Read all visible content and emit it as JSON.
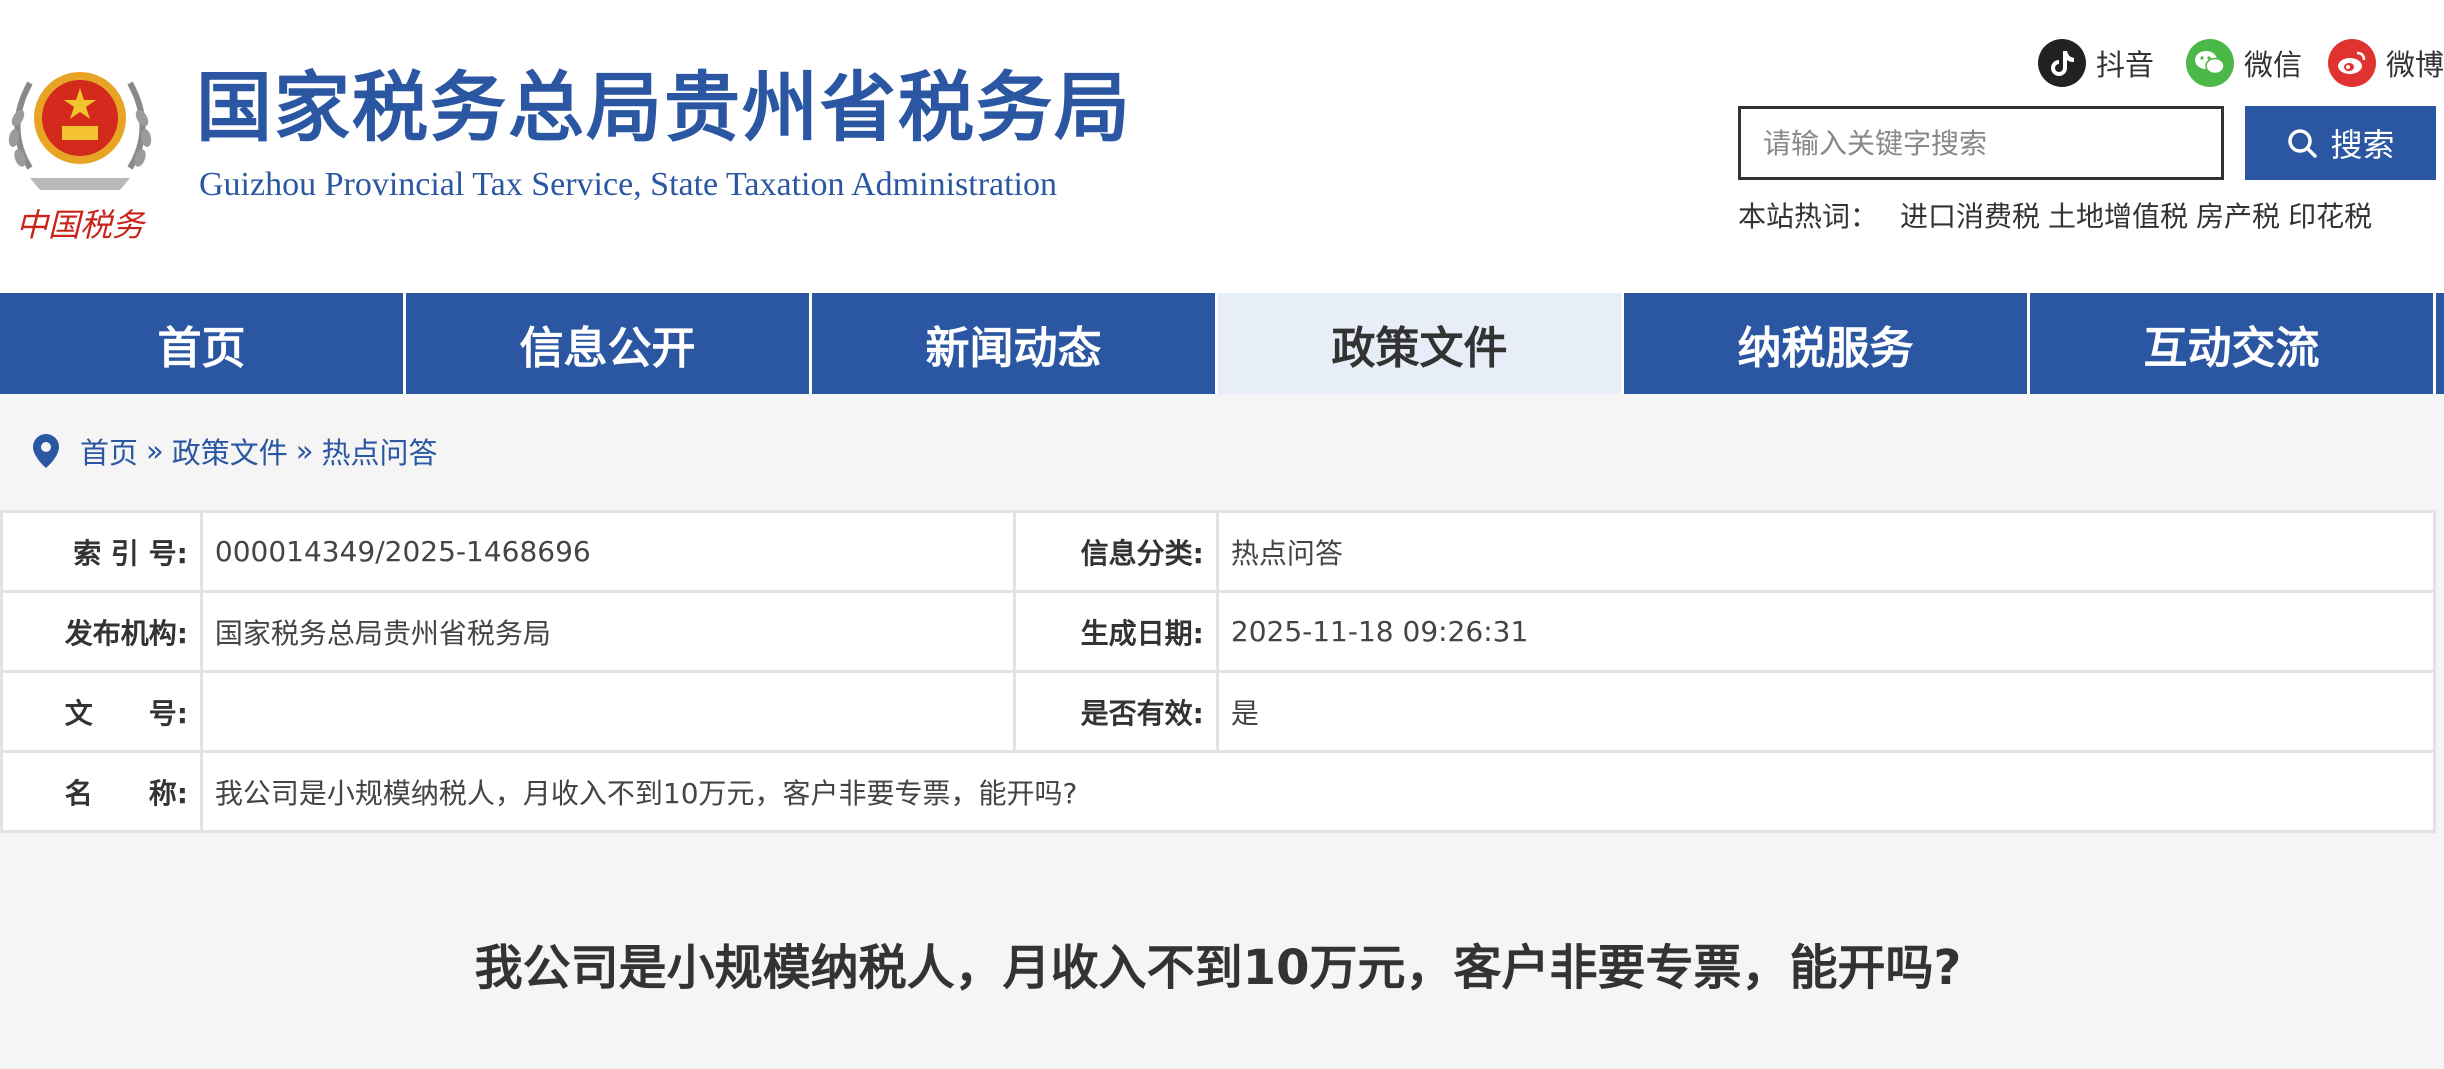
{
  "header": {
    "title_cn": "国家税务总局贵州省税务局",
    "title_en": "Guizhou Provincial Tax Service, State Taxation Administration",
    "emblem_text": "中国税务",
    "social": [
      {
        "label": "抖音",
        "icon": "douyin-icon",
        "color": "#222222"
      },
      {
        "label": "微信",
        "icon": "wechat-icon",
        "color": "#4cb848"
      },
      {
        "label": "微博",
        "icon": "weibo-icon",
        "color": "#e0322e"
      }
    ],
    "search": {
      "placeholder": "请输入关键字搜索",
      "button_label": "搜索"
    },
    "hot_words_label": "本站热词：",
    "hot_words": [
      "进口消费税",
      "土地增值税",
      "房产税",
      "印花税"
    ]
  },
  "nav": {
    "items": [
      "首页",
      "信息公开",
      "新闻动态",
      "政策文件",
      "纳税服务",
      "互动交流"
    ],
    "active_index": 3
  },
  "breadcrumb": {
    "items": [
      "首页",
      "政策文件",
      "热点问答"
    ],
    "separator": "»"
  },
  "info": {
    "index_no_label": "索 引 号:",
    "index_no": "000014349/2025-1468696",
    "category_label": "信息分类:",
    "category": "热点问答",
    "publisher_label": "发布机构:",
    "publisher": "国家税务总局贵州省税务局",
    "date_label": "生成日期:",
    "date": "2025-11-18 09:26:31",
    "doc_no_label": "文　　号:",
    "doc_no": "",
    "valid_label": "是否有效:",
    "valid": "是",
    "name_label": "名　　称:",
    "name": "我公司是小规模纳税人，月收入不到10万元，客户非要专票，能开吗?"
  },
  "article": {
    "title": "我公司是小规模纳税人，月收入不到10万元，客户非要专票，能开吗?"
  },
  "colors": {
    "brand_blue": "#2a56a2",
    "nav_active_bg": "#e8eef7",
    "page_bg": "#f5f5f5"
  }
}
